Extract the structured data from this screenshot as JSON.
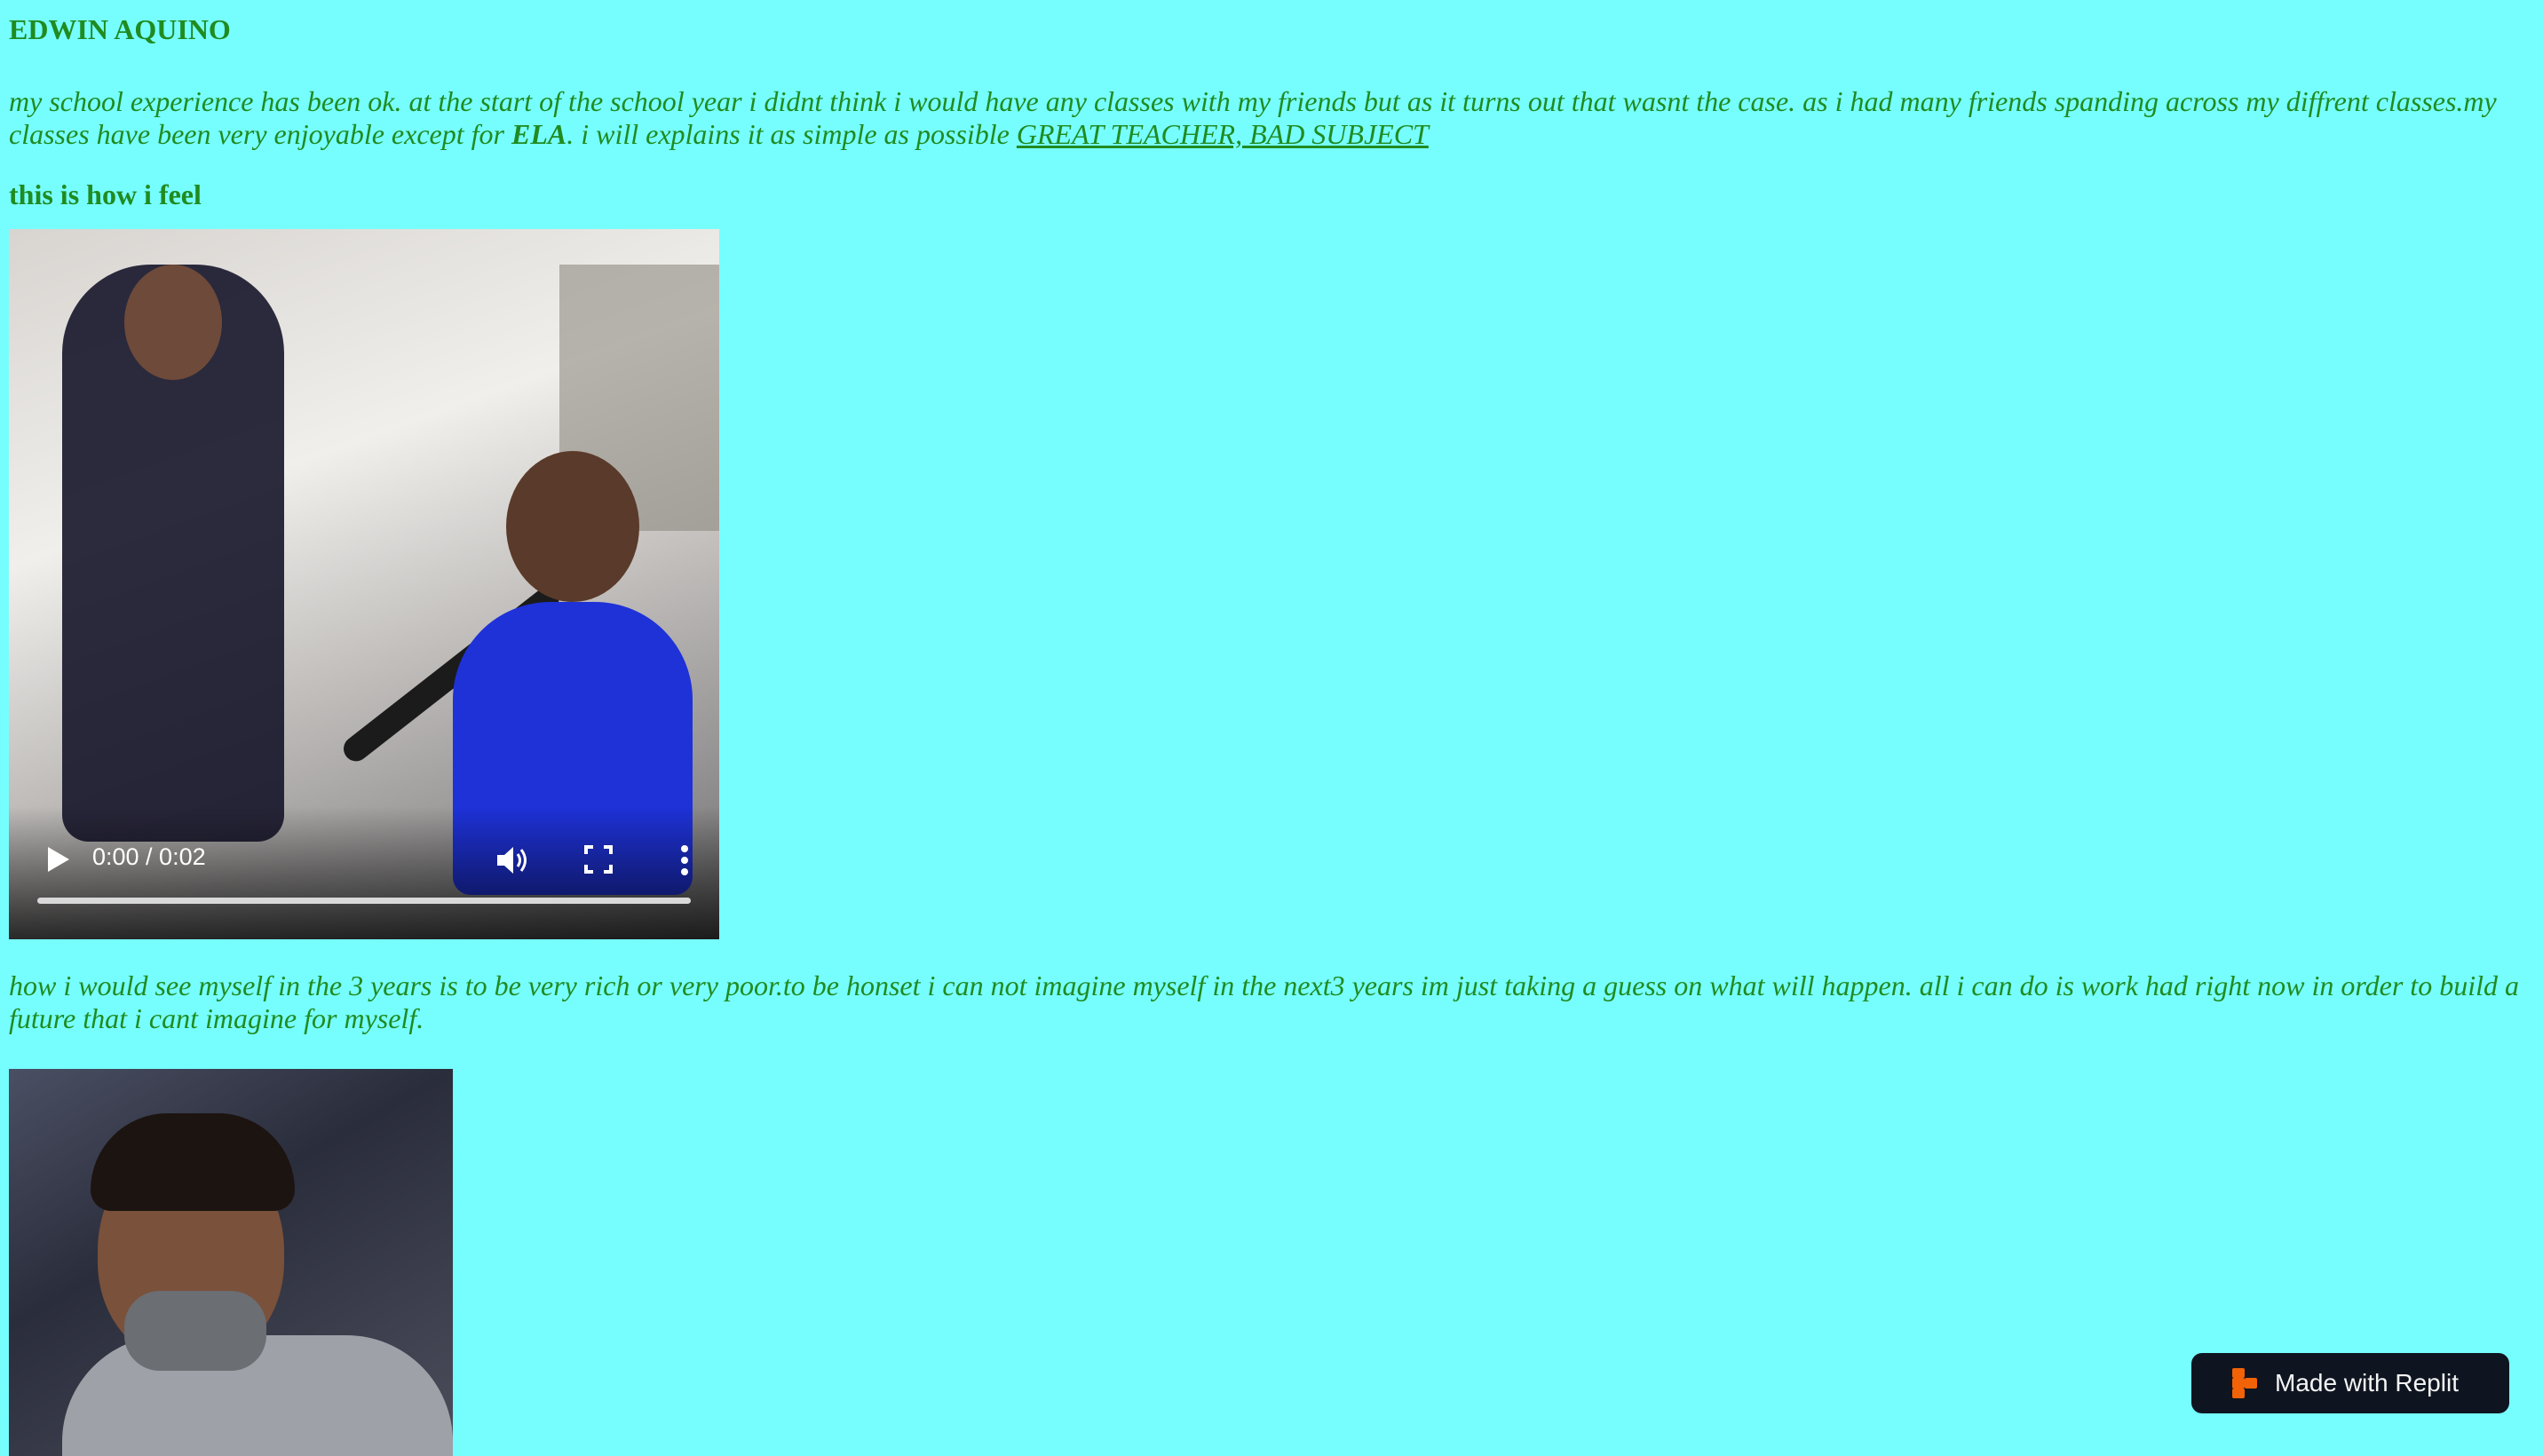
{
  "page": {
    "title": "EDWIN AQUINO",
    "intro": {
      "text_before_bold": "my school experience has been ok. at the start of the school year i didnt think i would have any classes with my friends but as it turns out that wasnt the case. as i had many friends spanding across my diffrent classes.my classes have been very enjoyable except for ",
      "bold": "ELA",
      "text_after_bold": ". i will explains it as simple as possible ",
      "link": "GREAT TEACHER, BAD SUBJECT"
    },
    "subtitle": "this is how i feel",
    "video": {
      "time": "0:00 / 0:02",
      "progress_fraction": 0.0,
      "icons": {
        "play": "play-icon",
        "volume": "volume-icon",
        "fullscreen": "fullscreen-icon",
        "more": "more-vert-icon"
      }
    },
    "future_paragraph": "how i would see myself in the 3 years is to be very rich or very poor.to be honset i can not imagine myself in the next3 years im just taking a guess on what will happen. all i can do is work had right now in order to build a future that i cant imagine for myself.",
    "badge": {
      "label": "Made with Replit",
      "icon": "replit-logo-icon"
    }
  },
  "colors": {
    "background": "#76feff",
    "text": "#208b20",
    "badge_bg": "#0f1520",
    "replit_orange": "#f26207"
  }
}
